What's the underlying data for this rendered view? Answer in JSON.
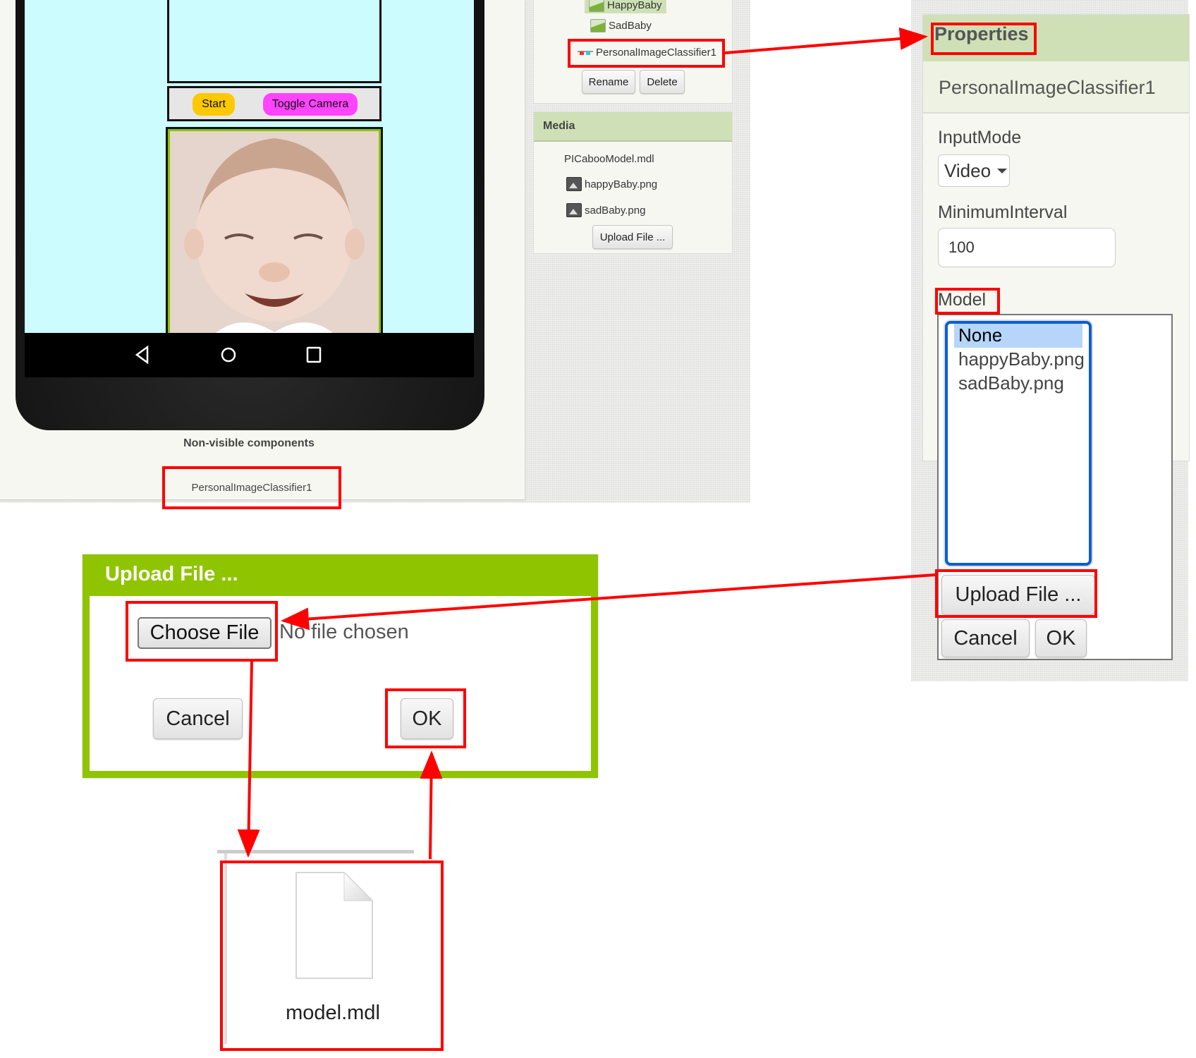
{
  "viewer": {
    "buttons": {
      "start": "Start",
      "toggle_camera": "Toggle Camera"
    },
    "nav_icons": [
      "back-icon",
      "home-icon",
      "recents-icon"
    ],
    "non_visible_heading": "Non-visible components",
    "non_visible_items": [
      "PersonalImageClassifier1"
    ],
    "colors": {
      "screen_bg": "#ccfcfe",
      "start_button": "#ffc800",
      "toggle_button": "#ff44ff"
    }
  },
  "components": {
    "items": [
      {
        "label": "HappyBaby",
        "icon": "image-icon",
        "selected": true
      },
      {
        "label": "SadBaby",
        "icon": "image-icon",
        "selected": false
      },
      {
        "label": "PersonalImageClassifier1",
        "icon": "classifier-icon",
        "selected": false
      }
    ],
    "rename_label": "Rename",
    "delete_label": "Delete"
  },
  "media": {
    "title": "Media",
    "items": [
      {
        "label": "PICabooModel.mdl",
        "icon": null
      },
      {
        "label": "happyBaby.png",
        "icon": "picture-icon"
      },
      {
        "label": "sadBaby.png",
        "icon": "picture-icon"
      }
    ],
    "upload_label": "Upload File ..."
  },
  "properties": {
    "title": "Properties",
    "component_name": "PersonalImageClassifier1",
    "input_mode": {
      "label": "InputMode",
      "value": "Video"
    },
    "minimum_interval": {
      "label": "MinimumInterval",
      "value": "100"
    },
    "model": {
      "label": "Model",
      "options": [
        "None",
        "happyBaby.png",
        "sadBaby.png"
      ],
      "selected": "None",
      "upload_label": "Upload File ...",
      "cancel_label": "Cancel",
      "ok_label": "OK"
    }
  },
  "upload_dialog": {
    "title": "Upload File ...",
    "choose_file_label": "Choose File",
    "no_file_text": "No file chosen",
    "cancel_label": "Cancel",
    "ok_label": "OK",
    "accent": "#8fc400"
  },
  "file_picker": {
    "file_name": "model.mdl"
  },
  "annotation": {
    "highlight_color": "#ff0000"
  }
}
